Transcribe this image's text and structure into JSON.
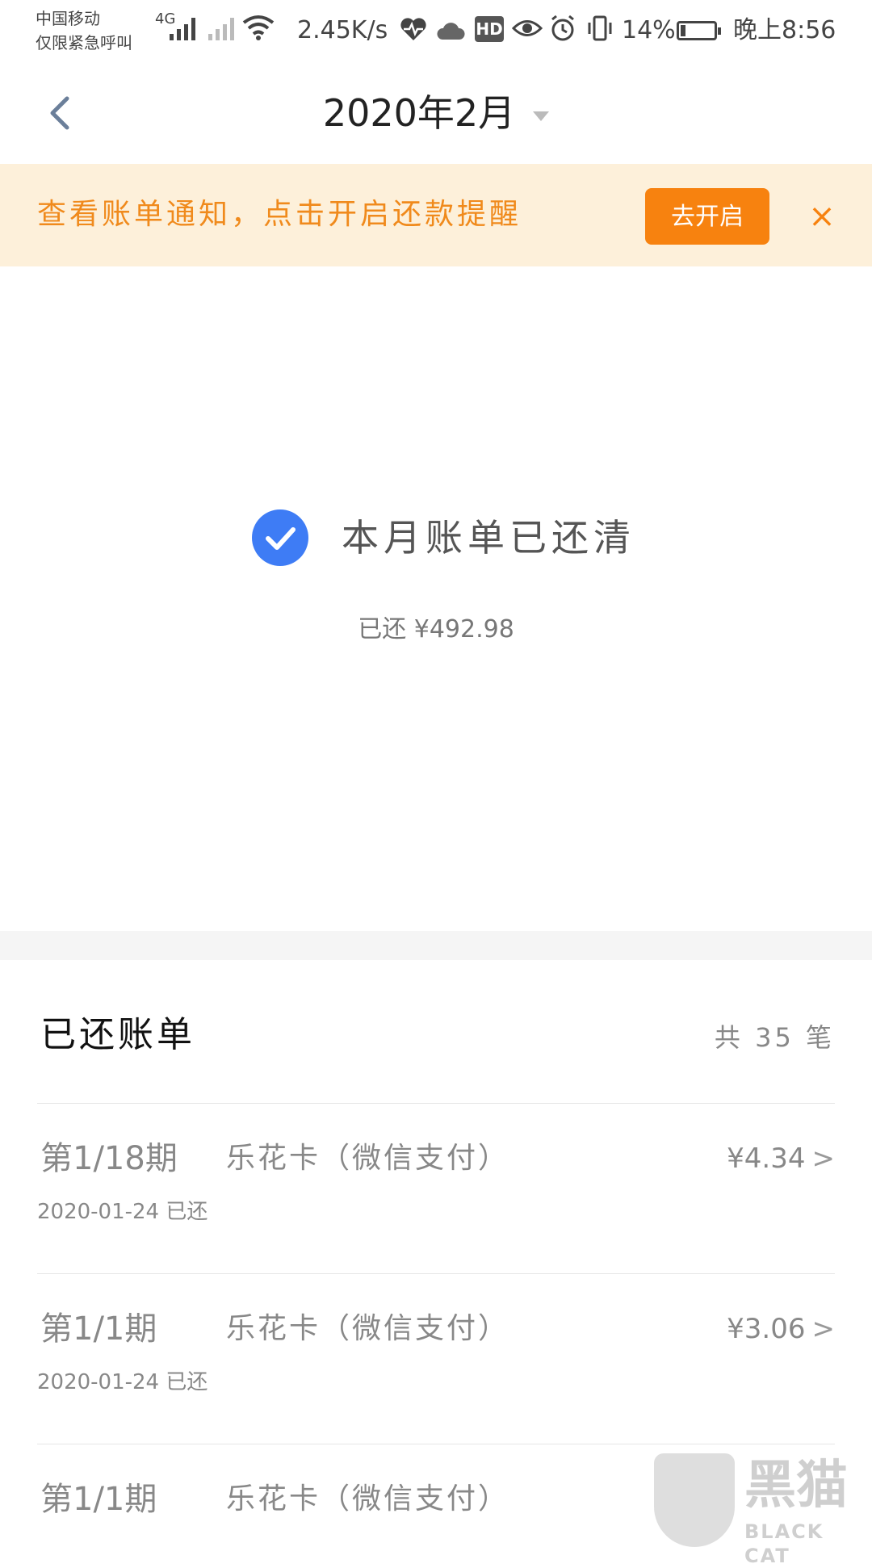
{
  "status_bar": {
    "carrier_line1": "中国移动",
    "carrier_line2": "仅限紧急呼叫",
    "network": "4G",
    "speed": "2.45K/s",
    "hd": "HD",
    "battery_percent": "14%",
    "time": "晚上8:56"
  },
  "header": {
    "title": "2020年2月"
  },
  "banner": {
    "text": "查看账单通知，点击开启还款提醒",
    "button_label": "去开启",
    "close_label": "×"
  },
  "summary": {
    "title": "本月账单已还清",
    "amount_text": "已还 ¥492.98"
  },
  "paid_list": {
    "title": "已还账单",
    "count_text": "共 35 笔",
    "rows": [
      {
        "period": "第1/18期",
        "merchant": "乐花卡（微信支付）",
        "amount": "¥4.34",
        "date": "2020-01-24 已还"
      },
      {
        "period": "第1/1期",
        "merchant": "乐花卡（微信支付）",
        "amount": "¥3.06",
        "date": "2020-01-24 已还"
      },
      {
        "period": "第1/1期",
        "merchant": "乐花卡（微信支付）",
        "amount": "",
        "date": ""
      }
    ]
  },
  "watermark": {
    "cn": "黑猫",
    "en": "BLACK CAT"
  },
  "colors": {
    "accent_orange": "#f7820f",
    "banner_bg": "#fdf0da",
    "check_blue": "#3e7cf5"
  },
  "icons": {
    "back": "chevron-left-icon",
    "dropdown": "caret-down-icon",
    "check": "check-icon",
    "row_arrow": "chevron-right-icon"
  }
}
